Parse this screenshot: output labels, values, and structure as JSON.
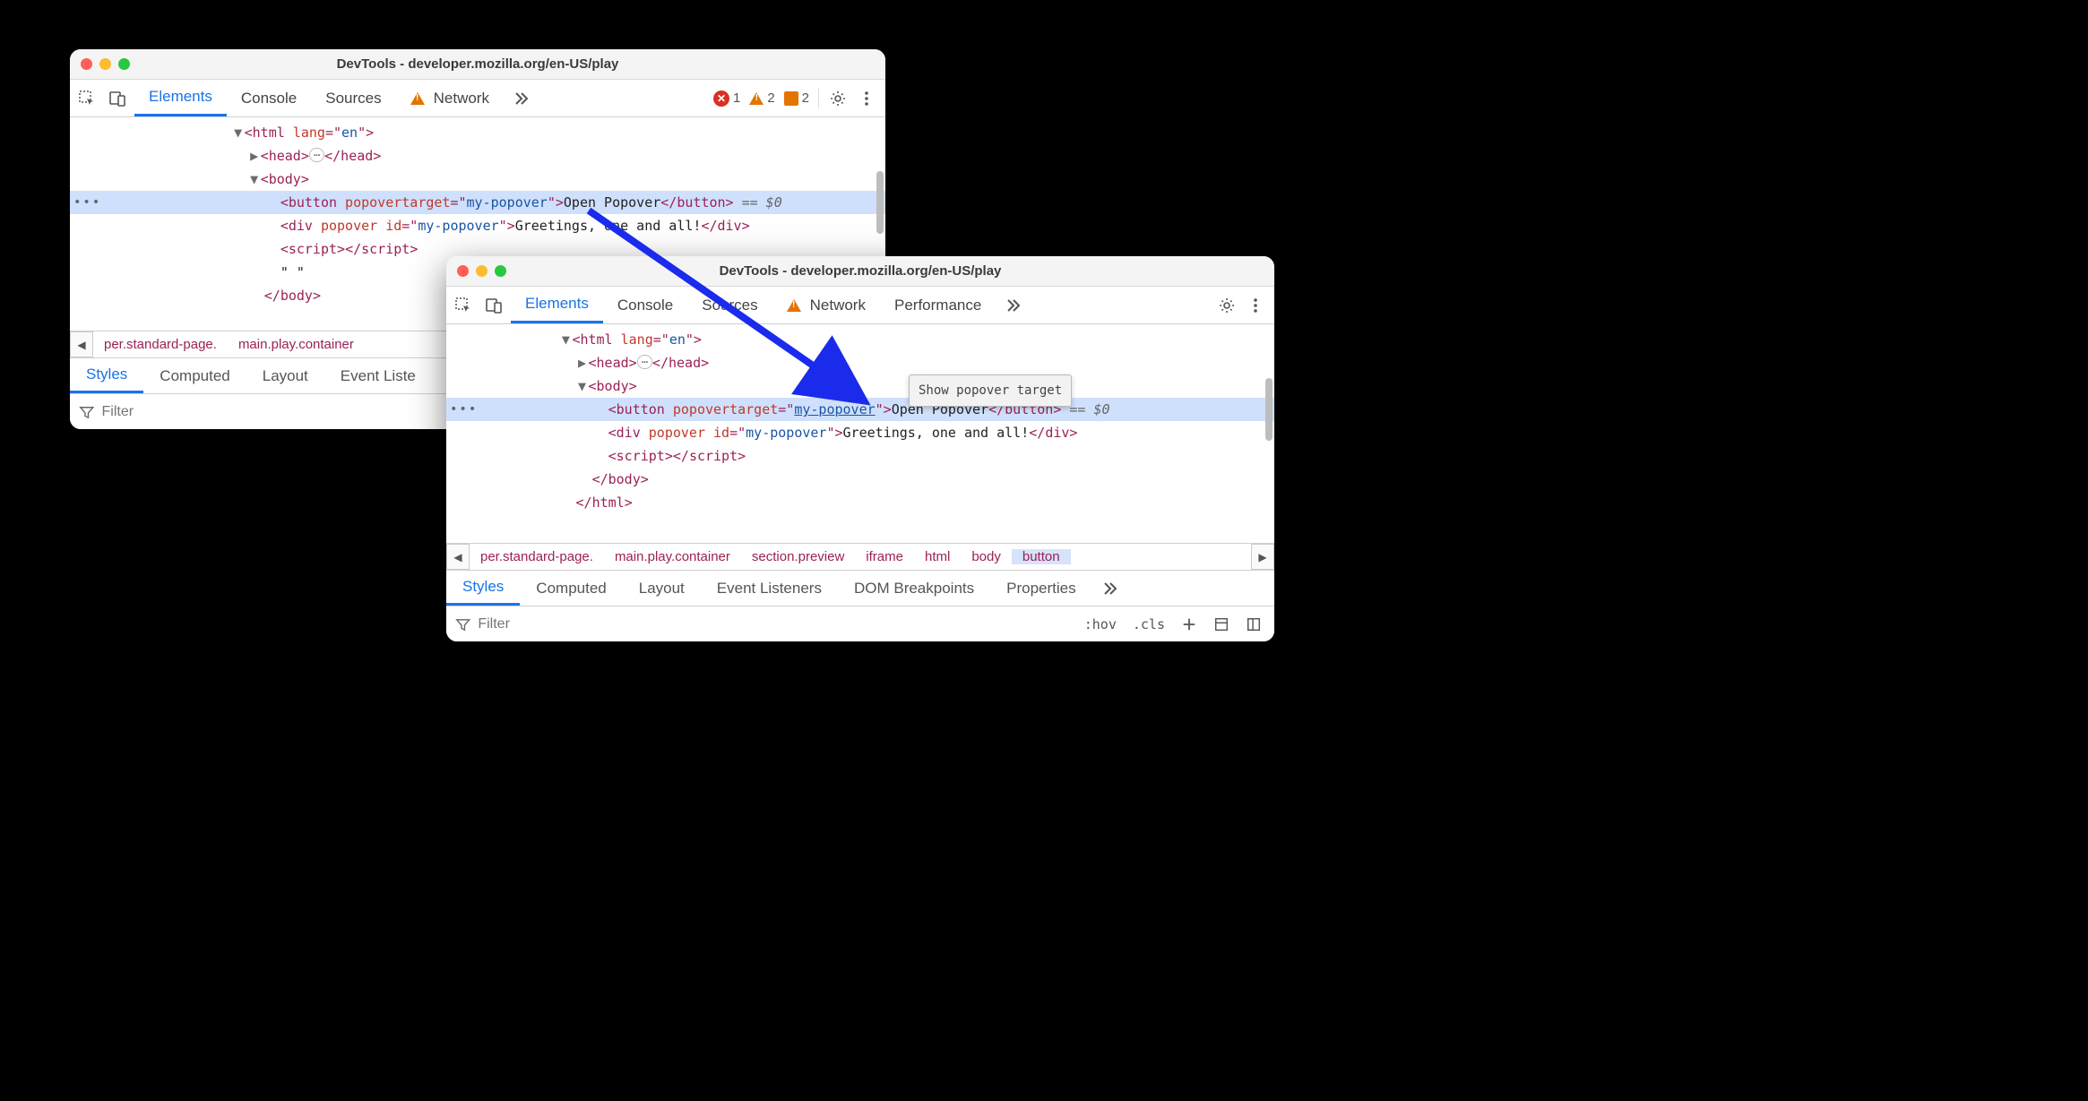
{
  "win1": {
    "title": "DevTools - developer.mozilla.org/en-US/play",
    "tabs": {
      "elements": "Elements",
      "console": "Console",
      "sources": "Sources",
      "network": "Network"
    },
    "badges": {
      "error": "1",
      "warn": "2",
      "info": "2"
    },
    "dom": {
      "l1_a": "<",
      "l1_b": "html",
      "l1_c": " lang",
      "l1_d": "=\"",
      "l1_e": "en",
      "l1_f": "\">",
      "l2_a": "<",
      "l2_b": "head",
      "l2_c": ">",
      "l2_pill": "⋯",
      "l2_d": "</",
      "l2_e": "head",
      "l2_f": ">",
      "l3_a": "<",
      "l3_b": "body",
      "l3_c": ">",
      "l4_a": "<",
      "l4_b": "button",
      "l4_c": " popovertarget",
      "l4_d": "=\"",
      "l4_e": "my-popover",
      "l4_f": "\">",
      "l4_g": "Open Popover",
      "l4_h": "</",
      "l4_i": "button",
      "l4_j": ">",
      "l4_k": " == $0",
      "l5_a": "<",
      "l5_b": "div",
      "l5_c": " popover id",
      "l5_d": "=\"",
      "l5_e": "my-popover",
      "l5_f": "\">",
      "l5_g": "Greetings, one and all!",
      "l5_h": "</",
      "l5_i": "div",
      "l5_j": ">",
      "l6_a": "<",
      "l6_b": "script",
      "l6_c": ">",
      "l6_d": "</",
      "l6_e": "script",
      "l6_f": ">",
      "l7": "\" \"",
      "l8_a": "</",
      "l8_b": "body",
      "l8_c": ">"
    },
    "crumbs": {
      "c1": "per.standard-page.",
      "c2": "main.play.container"
    },
    "subtabs": {
      "styles": "Styles",
      "computed": "Computed",
      "layout": "Layout",
      "event": "Event Liste"
    },
    "filter_placeholder": "Filter"
  },
  "win2": {
    "title": "DevTools - developer.mozilla.org/en-US/play",
    "tabs": {
      "elements": "Elements",
      "console": "Console",
      "sources": "Sources",
      "network": "Network",
      "performance": "Performance"
    },
    "tooltip": "Show popover target",
    "dom": {
      "l1_a": "<",
      "l1_b": "html",
      "l1_c": " lang",
      "l1_d": "=\"",
      "l1_e": "en",
      "l1_f": "\">",
      "l2_a": "<",
      "l2_b": "head",
      "l2_c": ">",
      "l2_pill": "⋯",
      "l2_d": "</",
      "l2_e": "head",
      "l2_f": ">",
      "l3_a": "<",
      "l3_b": "body",
      "l3_c": ">",
      "l4_a": "<",
      "l4_b": "button",
      "l4_c": " popovertarget",
      "l4_d": "=\"",
      "l4_e": "my-popover",
      "l4_f": "\">",
      "l4_g": "Open Popover",
      "l4_h": "</",
      "l4_i": "button",
      "l4_j": ">",
      "l4_k": " == $0",
      "l5_a": "<",
      "l5_b": "div",
      "l5_c": " popover id",
      "l5_d": "=\"",
      "l5_e": "my-popover",
      "l5_f": "\">",
      "l5_g": "Greetings, one and all!",
      "l5_h": "</",
      "l5_i": "div",
      "l5_j": ">",
      "l6_a": "<",
      "l6_b": "script",
      "l6_c": ">",
      "l6_d": "</",
      "l6_e": "script",
      "l6_f": ">",
      "l7_a": "</",
      "l7_b": "body",
      "l7_c": ">",
      "l8_a": "</",
      "l8_b": "html",
      "l8_c": ">"
    },
    "crumbs": {
      "c1": "per.standard-page.",
      "c2": "main.play.container",
      "c3": "section.preview",
      "c4": "iframe",
      "c5": "html",
      "c6": "body",
      "c7": "button"
    },
    "subtabs": {
      "styles": "Styles",
      "computed": "Computed",
      "layout": "Layout",
      "event": "Event Listeners",
      "dom": "DOM Breakpoints",
      "props": "Properties"
    },
    "filter_placeholder": "Filter",
    "hov": ":hov",
    "cls": ".cls"
  }
}
